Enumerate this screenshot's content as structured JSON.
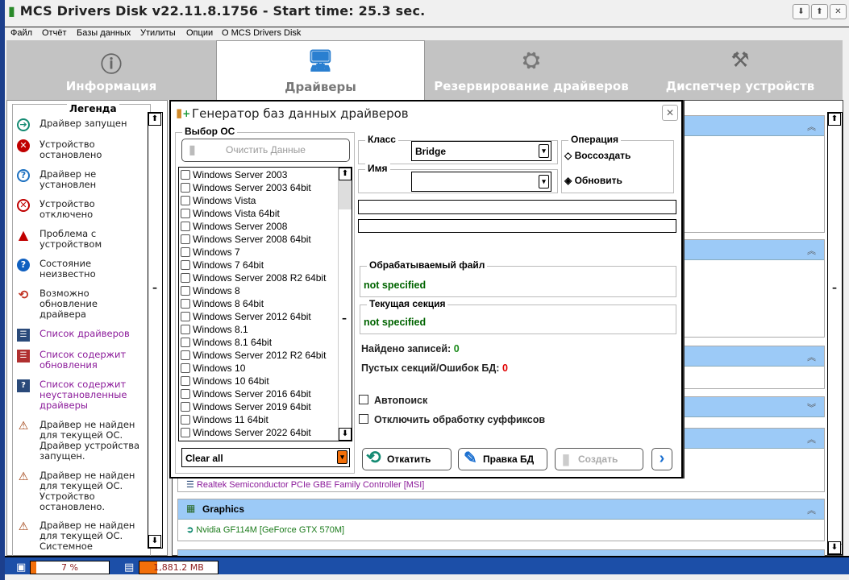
{
  "window": {
    "title": "MCS Drivers Disk v22.11.8.1756 - Start time: 25.3 sec.",
    "buttons": [
      "minimize",
      "maximize",
      "close"
    ]
  },
  "menu": [
    "Файл",
    "Отчёт",
    "Базы данных",
    "Утилиты",
    "Опции",
    "О MCS Drivers Disk"
  ],
  "tabs": [
    {
      "label": "Информация",
      "icon": "info-icon"
    },
    {
      "label": "Драйверы",
      "icon": "monitor-disc-icon",
      "active": true
    },
    {
      "label": "Резервирование драйверов",
      "icon": "backup-icon"
    },
    {
      "label": "Диспетчер устройств",
      "icon": "tools-icon"
    }
  ],
  "legend": {
    "title": "Легенда",
    "items": [
      {
        "label": "Драйвер запущен",
        "icon": "arrow-right-circle-icon",
        "color": "#138a72"
      },
      {
        "label": "Устройство остановлено",
        "icon": "x-circle-red-icon",
        "color": "#c00000"
      },
      {
        "label": "Драйвер не установлен",
        "icon": "question-outline-icon",
        "color": "#1a6fc0"
      },
      {
        "label": "Устройство отключено",
        "icon": "x-circle-outline-icon",
        "color": "#c00000"
      },
      {
        "label": "Проблема с устройством",
        "icon": "warning-icon",
        "color": "#c00000"
      },
      {
        "label": "Состояние неизвестно",
        "icon": "question-filled-icon",
        "color": "#1060c0"
      },
      {
        "label": "Возможно обновление драйвера",
        "icon": "refresh-icon",
        "color": "#1a8a4a"
      },
      {
        "label": "Список драйверов",
        "icon": "list-icon",
        "color": "#8b1a9a"
      },
      {
        "label": "Список содержит обновления",
        "icon": "list-update-icon",
        "color": "#8b1a9a"
      },
      {
        "label": "Список содержит неустановленные драйверы",
        "icon": "list-question-icon",
        "color": "#8b1a9a"
      },
      {
        "label": "Драйвер не найден для текущей ОС. Драйвер устройства запущен.",
        "icon": "warning-arrow-icon",
        "color": "#222"
      },
      {
        "label": "Драйвер не найден для текущей ОС. Устройство остановлено.",
        "icon": "warning-x-icon",
        "color": "#222"
      },
      {
        "label": "Драйвер не найден для текущей ОС. Системное",
        "icon": "warning-system-icon",
        "color": "#222"
      }
    ]
  },
  "main": {
    "groups": [
      {
        "name": "",
        "items": [],
        "collapsed": false
      },
      {
        "name": "",
        "items": [],
        "collapsed": false
      },
      {
        "name": "",
        "items": [],
        "collapsed": false
      },
      {
        "name": "",
        "items": [],
        "collapsed": true
      },
      {
        "name": "",
        "items": [
          "Realtek Semiconductor PCIe GBE Family Controller [MSI]"
        ],
        "collapsed": false
      },
      {
        "name": "Graphics",
        "items": [
          "Nvidia GF114M [GeForce GTX 570M]"
        ],
        "collapsed": false
      },
      {
        "name": "",
        "items": [],
        "collapsed": false
      }
    ]
  },
  "dialog": {
    "title": "Генератор баз данных драйверов",
    "os_group": "Выбор ОС",
    "clear_data": "Очистить Данные",
    "os_list": [
      "Windows Server 2003",
      "Windows Server 2003 64bit",
      "Windows Vista",
      "Windows Vista 64bit",
      "Windows Server 2008",
      "Windows Server 2008 64bit",
      "Windows 7",
      "Windows 7 64bit",
      "Windows Server 2008 R2 64bit",
      "Windows 8",
      "Windows 8 64bit",
      "Windows Server 2012 64bit",
      "Windows 8.1",
      "Windows 8.1 64bit",
      "Windows Server 2012 R2 64bit",
      "Windows 10",
      "Windows 10 64bit",
      "Windows Server 2016 64bit",
      "Windows Server 2019 64bit",
      "Windows 11 64bit",
      "Windows Server 2022 64bit"
    ],
    "select_combo": "Clear all",
    "class_label": "Класс",
    "class_value": "Bridge",
    "name_label": "Имя",
    "name_value": "",
    "operation_label": "Операция",
    "op_recreate": "Воссоздать",
    "op_update": "Обновить",
    "operation_selected": "Обновить",
    "processed_file_label": "Обрабатываемый файл",
    "processed_file": "not specified",
    "current_section_label": "Текущая секция",
    "current_section": "not specified",
    "found_label": "Найдено записей:",
    "found": "0",
    "empty_label": "Пустых секций/Ошибок БД:",
    "empty": "0",
    "autosearch": "Автопоиск",
    "disable_suffix": "Отключить обработку суффиксов",
    "rollback": "Откатить",
    "edit_db": "Правка БД",
    "create": "Создать"
  },
  "status": {
    "cpu": "7 %",
    "cpu_percent": 7,
    "memory": "1,881.2 MB",
    "memory_percent": 23
  }
}
